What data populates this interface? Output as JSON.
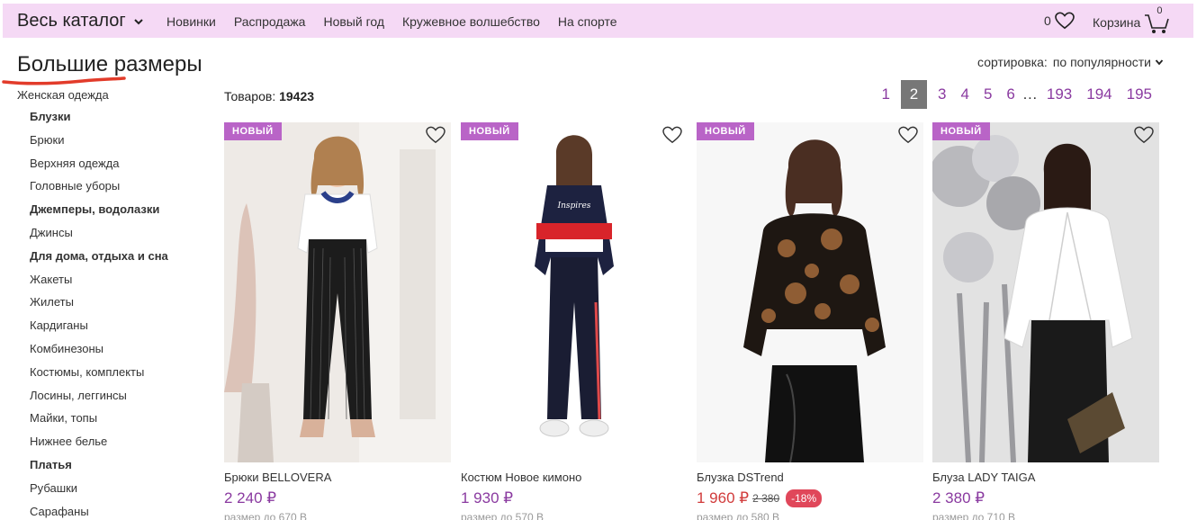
{
  "header": {
    "catalog_label": "Весь каталог",
    "nav": [
      "Новинки",
      "Распродажа",
      "Новый год",
      "Кружевное волшебство",
      "На спорте"
    ],
    "favorites_count": "0",
    "cart_label": "Корзина",
    "cart_count": "0"
  },
  "page": {
    "title": "Большие размеры",
    "sort_label": "сортировка:",
    "sort_value": "по популярности",
    "count_label": "Товаров:",
    "count_value": "19423"
  },
  "sidebar": {
    "parent": "Женская одежда",
    "items": [
      {
        "label": "Блузки",
        "bold": true
      },
      {
        "label": "Брюки",
        "bold": false
      },
      {
        "label": "Верхняя одежда",
        "bold": false
      },
      {
        "label": "Головные уборы",
        "bold": false
      },
      {
        "label": "Джемперы, водолазки",
        "bold": true
      },
      {
        "label": "Джинсы",
        "bold": false
      },
      {
        "label": "Для дома, отдыха и сна",
        "bold": true
      },
      {
        "label": "Жакеты",
        "bold": false
      },
      {
        "label": "Жилеты",
        "bold": false
      },
      {
        "label": "Кардиганы",
        "bold": false
      },
      {
        "label": "Комбинезоны",
        "bold": false
      },
      {
        "label": "Костюмы, комплекты",
        "bold": false
      },
      {
        "label": "Лосины, леггинсы",
        "bold": false
      },
      {
        "label": "Майки, топы",
        "bold": false
      },
      {
        "label": "Нижнее белье",
        "bold": false
      },
      {
        "label": "Платья",
        "bold": true
      },
      {
        "label": "Рубашки",
        "bold": false
      },
      {
        "label": "Сарафаны",
        "bold": false
      }
    ]
  },
  "pagination": {
    "pages": [
      "1",
      "2",
      "3",
      "4",
      "5",
      "6"
    ],
    "active": "2",
    "ellipsis": "…",
    "tail": [
      "193",
      "194",
      "195"
    ]
  },
  "products": [
    {
      "badge": "НОВЫЙ",
      "name": "Брюки BELLOVERA",
      "price": "2 240 ₽",
      "sub": "размер до 670 В",
      "sale": false
    },
    {
      "badge": "НОВЫЙ",
      "name": "Костюм Новое кимоно",
      "price": "1 930 ₽",
      "sub": "размер до 570 В",
      "sale": false
    },
    {
      "badge": "НОВЫЙ",
      "name": "Блузка DSTrend",
      "price": "1 960 ₽",
      "old_price": "2 380",
      "discount": "-18%",
      "sub": "размер до 580 В",
      "sale": true
    },
    {
      "badge": "НОВЫЙ",
      "name": "Блуза LADY TAIGA",
      "price": "2 380 ₽",
      "sub": "размер до 710 В",
      "sale": false
    }
  ],
  "colors": {
    "topbar_bg": "#f5d9f5",
    "accent": "#8a3aa0",
    "badge": "#b964c7",
    "sale": "#d13b3b",
    "discount_bg": "#e0475a",
    "title_underline": "#e23b2a"
  }
}
